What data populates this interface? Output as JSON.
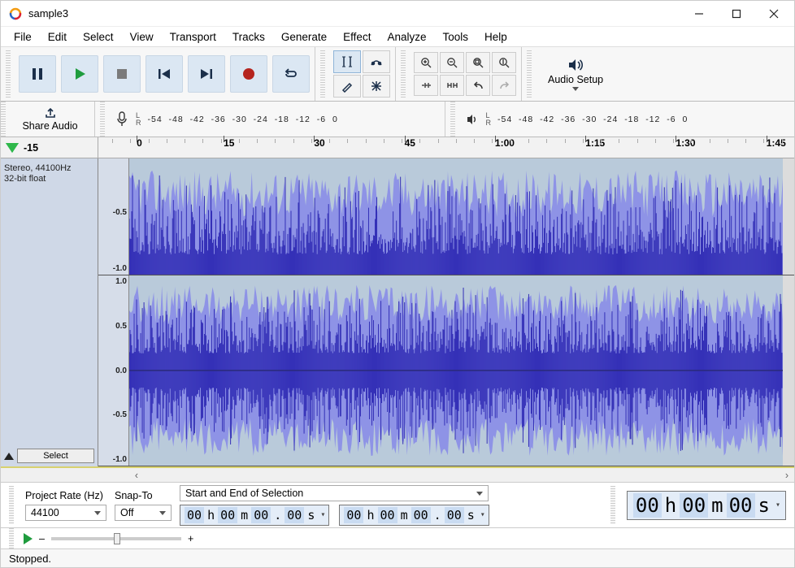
{
  "window": {
    "title": "sample3"
  },
  "menus": [
    "File",
    "Edit",
    "Select",
    "View",
    "Transport",
    "Tracks",
    "Generate",
    "Effect",
    "Analyze",
    "Tools",
    "Help"
  ],
  "transport": {
    "pause": "pause-button",
    "play": "play-button",
    "stop": "stop-button",
    "skip_start": "skip-to-start-button",
    "skip_end": "skip-to-end-button",
    "record": "record-button",
    "loop": "loop-button"
  },
  "audio_setup_label": "Audio Setup",
  "share_audio_label": "Share Audio",
  "meter_ticks": [
    "-54",
    "-48",
    "-42",
    "-36",
    "-30",
    "-24",
    "-18",
    "-12",
    "-6",
    "0"
  ],
  "lr": {
    "L": "L",
    "R": "R"
  },
  "timeline": {
    "labels": [
      {
        "pos": -3,
        "text": "-15"
      },
      {
        "pos": 5.5,
        "text": "0"
      },
      {
        "pos": 18,
        "text": "15"
      },
      {
        "pos": 31,
        "text": "30"
      },
      {
        "pos": 44,
        "text": "45"
      },
      {
        "pos": 57,
        "text": "1:00"
      },
      {
        "pos": 70,
        "text": "1:15"
      },
      {
        "pos": 83,
        "text": "1:30"
      },
      {
        "pos": 96,
        "text": "1:45"
      }
    ]
  },
  "track": {
    "mode": "Stereo, 44100Hz",
    "format": "32-bit float",
    "select_label": "Select",
    "amp_labels_top": [
      "",
      "-0.5",
      "-1.0"
    ],
    "amp_labels_bottom": [
      "1.0",
      "0.5",
      "0.0",
      "-0.5",
      "-1.0"
    ]
  },
  "selection": {
    "project_rate_label": "Project Rate (Hz)",
    "project_rate_value": "44100",
    "snap_label": "Snap-To",
    "snap_value": "Off",
    "range_kind": "Start and End of Selection",
    "time1": {
      "h": "00",
      "m": "00",
      "s": "00",
      "cs": "00"
    },
    "time2": {
      "h": "00",
      "m": "00",
      "s": "00",
      "cs": "00"
    },
    "big": {
      "h": "00",
      "m": "00",
      "s": "00"
    }
  },
  "speed": {
    "minus": "–",
    "plus": "+"
  },
  "status": "Stopped."
}
